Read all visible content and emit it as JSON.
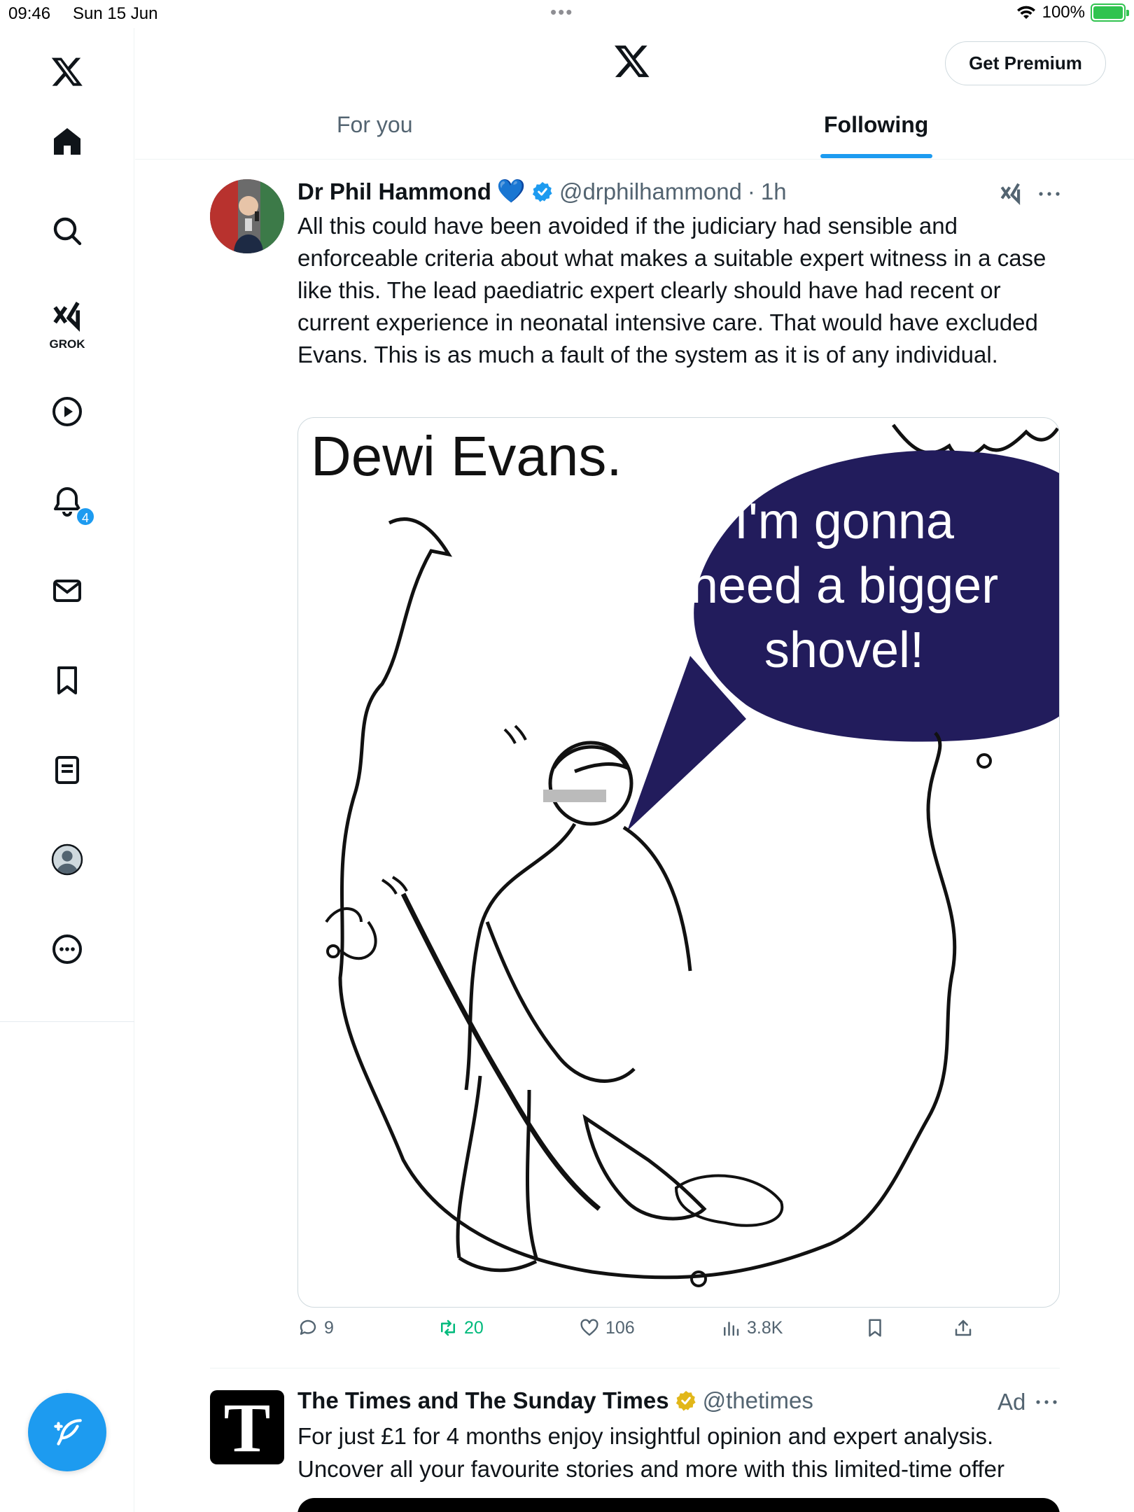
{
  "status_bar": {
    "time": "09:46",
    "date": "Sun 15 Jun",
    "battery": "100%"
  },
  "sidebar": {
    "grok_label": "GROK",
    "notification_count": "4",
    "accent_color": "#1d9bf0"
  },
  "header": {
    "premium_label": "Get Premium",
    "tabs": [
      {
        "label": "For you",
        "active": false
      },
      {
        "label": "Following",
        "active": true
      }
    ]
  },
  "tweet": {
    "author_name": "Dr Phil Hammond",
    "emoji": "💙",
    "handle": "@drphilhammond",
    "separator": "·",
    "time": "1h",
    "text": "All this could have been avoided if the judiciary had sensible and enforceable criteria about what makes a suitable expert witness in a case like this. The lead paediatric expert clearly should have had recent or current experience in neonatal intensive care. That would have excluded Evans. This is as much a fault of the system as it is of any individual.",
    "image": {
      "caption": "Dewi Evans.",
      "speech_line1": "I'm gonna",
      "speech_line2": "need a bigger",
      "speech_line3": "shovel!"
    },
    "stats": {
      "replies": "9",
      "reposts": "20",
      "likes": "106",
      "views": "3.8K"
    }
  },
  "ad": {
    "logo_letter": "T",
    "author_name": "The Times and The Sunday Times",
    "handle": "@thetimes",
    "ad_label": "Ad",
    "text": "For just £1 for 4 months enjoy insightful opinion and expert analysis. Uncover all your favourite stories and more with this limited-time offer"
  }
}
